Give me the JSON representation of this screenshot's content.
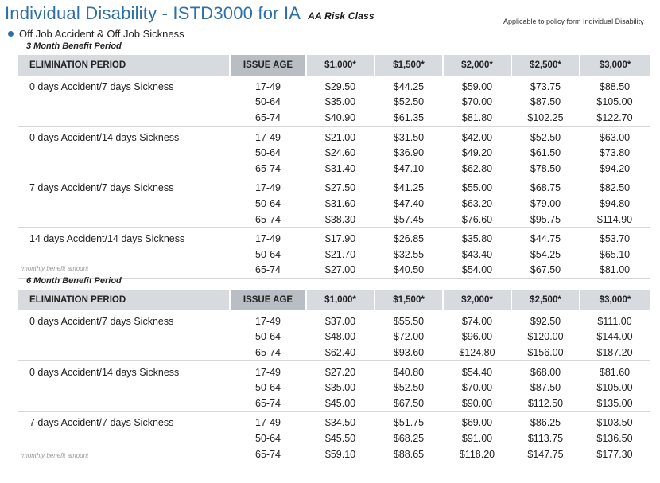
{
  "header": {
    "title": "Individual Disability - ISTD3000 for IA",
    "risk_class": "AA Risk Class",
    "applicable": "Applicable to policy form Individual Disability",
    "bullet": "Off Job Accident & Off Job Sickness"
  },
  "columns": {
    "elimination": "ELIMINATION PERIOD",
    "issue_age": "ISSUE AGE",
    "amounts": [
      "$1,000*",
      "$1,500*",
      "$2,000*",
      "$2,500*",
      "$3,000*"
    ]
  },
  "tables": [
    {
      "label": "3 Month Benefit Period",
      "footnote": "*monthly benefit amount",
      "groups": [
        {
          "elimination": "0 days Accident/7 days Sickness",
          "rows": [
            {
              "age": "17-49",
              "values": [
                "$29.50",
                "$44.25",
                "$59.00",
                "$73.75",
                "$88.50"
              ]
            },
            {
              "age": "50-64",
              "values": [
                "$35.00",
                "$52.50",
                "$70.00",
                "$87.50",
                "$105.00"
              ]
            },
            {
              "age": "65-74",
              "values": [
                "$40.90",
                "$61.35",
                "$81.80",
                "$102.25",
                "$122.70"
              ]
            }
          ]
        },
        {
          "elimination": "0 days Accident/14 days Sickness",
          "rows": [
            {
              "age": "17-49",
              "values": [
                "$21.00",
                "$31.50",
                "$42.00",
                "$52.50",
                "$63.00"
              ]
            },
            {
              "age": "50-64",
              "values": [
                "$24.60",
                "$36.90",
                "$49.20",
                "$61.50",
                "$73.80"
              ]
            },
            {
              "age": "65-74",
              "values": [
                "$31.40",
                "$47.10",
                "$62.80",
                "$78.50",
                "$94.20"
              ]
            }
          ]
        },
        {
          "elimination": "7 days Accident/7 days Sickness",
          "rows": [
            {
              "age": "17-49",
              "values": [
                "$27.50",
                "$41.25",
                "$55.00",
                "$68.75",
                "$82.50"
              ]
            },
            {
              "age": "50-64",
              "values": [
                "$31.60",
                "$47.40",
                "$63.20",
                "$79.00",
                "$94.80"
              ]
            },
            {
              "age": "65-74",
              "values": [
                "$38.30",
                "$57.45",
                "$76.60",
                "$95.75",
                "$114.90"
              ]
            }
          ]
        },
        {
          "elimination": "14 days Accident/14 days Sickness",
          "rows": [
            {
              "age": "17-49",
              "values": [
                "$17.90",
                "$26.85",
                "$35.80",
                "$44.75",
                "$53.70"
              ]
            },
            {
              "age": "50-64",
              "values": [
                "$21.70",
                "$32.55",
                "$43.40",
                "$54.25",
                "$65.10"
              ]
            },
            {
              "age": "65-74",
              "values": [
                "$27.00",
                "$40.50",
                "$54.00",
                "$67.50",
                "$81.00"
              ]
            }
          ]
        }
      ]
    },
    {
      "label": "6 Month Benefit Period",
      "footnote": "*monthly benefit amount",
      "groups": [
        {
          "elimination": "0 days Accident/7 days Sickness",
          "rows": [
            {
              "age": "17-49",
              "values": [
                "$37.00",
                "$55.50",
                "$74.00",
                "$92.50",
                "$111.00"
              ]
            },
            {
              "age": "50-64",
              "values": [
                "$48.00",
                "$72.00",
                "$96.00",
                "$120.00",
                "$144.00"
              ]
            },
            {
              "age": "65-74",
              "values": [
                "$62.40",
                "$93.60",
                "$124.80",
                "$156.00",
                "$187.20"
              ]
            }
          ]
        },
        {
          "elimination": "0 days Accident/14 days Sickness",
          "rows": [
            {
              "age": "17-49",
              "values": [
                "$27.20",
                "$40.80",
                "$54.40",
                "$68.00",
                "$81.60"
              ]
            },
            {
              "age": "50-64",
              "values": [
                "$35.00",
                "$52.50",
                "$70.00",
                "$87.50",
                "$105.00"
              ]
            },
            {
              "age": "65-74",
              "values": [
                "$45.00",
                "$67.50",
                "$90.00",
                "$112.50",
                "$135.00"
              ]
            }
          ]
        },
        {
          "elimination": "7 days Accident/7 days Sickness",
          "rows": [
            {
              "age": "17-49",
              "values": [
                "$34.50",
                "$51.75",
                "$69.00",
                "$86.25",
                "$103.50"
              ]
            },
            {
              "age": "50-64",
              "values": [
                "$45.50",
                "$68.25",
                "$91.00",
                "$113.75",
                "$136.50"
              ]
            },
            {
              "age": "65-74",
              "values": [
                "$59.10",
                "$88.65",
                "$118.20",
                "$147.75",
                "$177.30"
              ]
            }
          ]
        }
      ]
    }
  ]
}
